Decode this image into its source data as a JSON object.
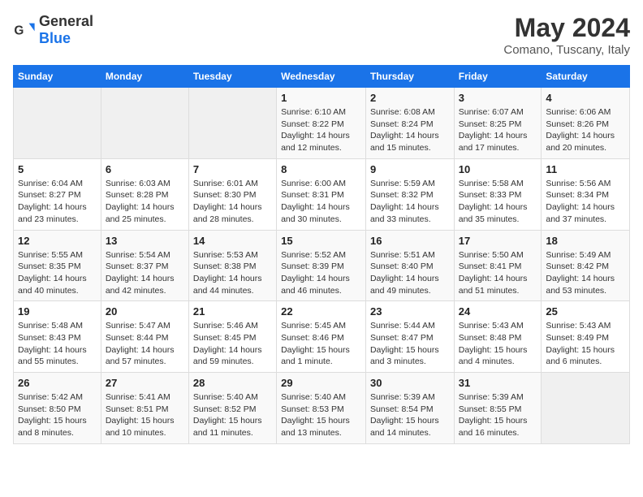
{
  "header": {
    "logo_general": "General",
    "logo_blue": "Blue",
    "title": "May 2024",
    "subtitle": "Comano, Tuscany, Italy"
  },
  "days_of_week": [
    "Sunday",
    "Monday",
    "Tuesday",
    "Wednesday",
    "Thursday",
    "Friday",
    "Saturday"
  ],
  "weeks": [
    [
      {
        "day": "",
        "info": ""
      },
      {
        "day": "",
        "info": ""
      },
      {
        "day": "",
        "info": ""
      },
      {
        "day": "1",
        "info": "Sunrise: 6:10 AM\nSunset: 8:22 PM\nDaylight: 14 hours\nand 12 minutes."
      },
      {
        "day": "2",
        "info": "Sunrise: 6:08 AM\nSunset: 8:24 PM\nDaylight: 14 hours\nand 15 minutes."
      },
      {
        "day": "3",
        "info": "Sunrise: 6:07 AM\nSunset: 8:25 PM\nDaylight: 14 hours\nand 17 minutes."
      },
      {
        "day": "4",
        "info": "Sunrise: 6:06 AM\nSunset: 8:26 PM\nDaylight: 14 hours\nand 20 minutes."
      }
    ],
    [
      {
        "day": "5",
        "info": "Sunrise: 6:04 AM\nSunset: 8:27 PM\nDaylight: 14 hours\nand 23 minutes."
      },
      {
        "day": "6",
        "info": "Sunrise: 6:03 AM\nSunset: 8:28 PM\nDaylight: 14 hours\nand 25 minutes."
      },
      {
        "day": "7",
        "info": "Sunrise: 6:01 AM\nSunset: 8:30 PM\nDaylight: 14 hours\nand 28 minutes."
      },
      {
        "day": "8",
        "info": "Sunrise: 6:00 AM\nSunset: 8:31 PM\nDaylight: 14 hours\nand 30 minutes."
      },
      {
        "day": "9",
        "info": "Sunrise: 5:59 AM\nSunset: 8:32 PM\nDaylight: 14 hours\nand 33 minutes."
      },
      {
        "day": "10",
        "info": "Sunrise: 5:58 AM\nSunset: 8:33 PM\nDaylight: 14 hours\nand 35 minutes."
      },
      {
        "day": "11",
        "info": "Sunrise: 5:56 AM\nSunset: 8:34 PM\nDaylight: 14 hours\nand 37 minutes."
      }
    ],
    [
      {
        "day": "12",
        "info": "Sunrise: 5:55 AM\nSunset: 8:35 PM\nDaylight: 14 hours\nand 40 minutes."
      },
      {
        "day": "13",
        "info": "Sunrise: 5:54 AM\nSunset: 8:37 PM\nDaylight: 14 hours\nand 42 minutes."
      },
      {
        "day": "14",
        "info": "Sunrise: 5:53 AM\nSunset: 8:38 PM\nDaylight: 14 hours\nand 44 minutes."
      },
      {
        "day": "15",
        "info": "Sunrise: 5:52 AM\nSunset: 8:39 PM\nDaylight: 14 hours\nand 46 minutes."
      },
      {
        "day": "16",
        "info": "Sunrise: 5:51 AM\nSunset: 8:40 PM\nDaylight: 14 hours\nand 49 minutes."
      },
      {
        "day": "17",
        "info": "Sunrise: 5:50 AM\nSunset: 8:41 PM\nDaylight: 14 hours\nand 51 minutes."
      },
      {
        "day": "18",
        "info": "Sunrise: 5:49 AM\nSunset: 8:42 PM\nDaylight: 14 hours\nand 53 minutes."
      }
    ],
    [
      {
        "day": "19",
        "info": "Sunrise: 5:48 AM\nSunset: 8:43 PM\nDaylight: 14 hours\nand 55 minutes."
      },
      {
        "day": "20",
        "info": "Sunrise: 5:47 AM\nSunset: 8:44 PM\nDaylight: 14 hours\nand 57 minutes."
      },
      {
        "day": "21",
        "info": "Sunrise: 5:46 AM\nSunset: 8:45 PM\nDaylight: 14 hours\nand 59 minutes."
      },
      {
        "day": "22",
        "info": "Sunrise: 5:45 AM\nSunset: 8:46 PM\nDaylight: 15 hours\nand 1 minute."
      },
      {
        "day": "23",
        "info": "Sunrise: 5:44 AM\nSunset: 8:47 PM\nDaylight: 15 hours\nand 3 minutes."
      },
      {
        "day": "24",
        "info": "Sunrise: 5:43 AM\nSunset: 8:48 PM\nDaylight: 15 hours\nand 4 minutes."
      },
      {
        "day": "25",
        "info": "Sunrise: 5:43 AM\nSunset: 8:49 PM\nDaylight: 15 hours\nand 6 minutes."
      }
    ],
    [
      {
        "day": "26",
        "info": "Sunrise: 5:42 AM\nSunset: 8:50 PM\nDaylight: 15 hours\nand 8 minutes."
      },
      {
        "day": "27",
        "info": "Sunrise: 5:41 AM\nSunset: 8:51 PM\nDaylight: 15 hours\nand 10 minutes."
      },
      {
        "day": "28",
        "info": "Sunrise: 5:40 AM\nSunset: 8:52 PM\nDaylight: 15 hours\nand 11 minutes."
      },
      {
        "day": "29",
        "info": "Sunrise: 5:40 AM\nSunset: 8:53 PM\nDaylight: 15 hours\nand 13 minutes."
      },
      {
        "day": "30",
        "info": "Sunrise: 5:39 AM\nSunset: 8:54 PM\nDaylight: 15 hours\nand 14 minutes."
      },
      {
        "day": "31",
        "info": "Sunrise: 5:39 AM\nSunset: 8:55 PM\nDaylight: 15 hours\nand 16 minutes."
      },
      {
        "day": "",
        "info": ""
      }
    ]
  ]
}
